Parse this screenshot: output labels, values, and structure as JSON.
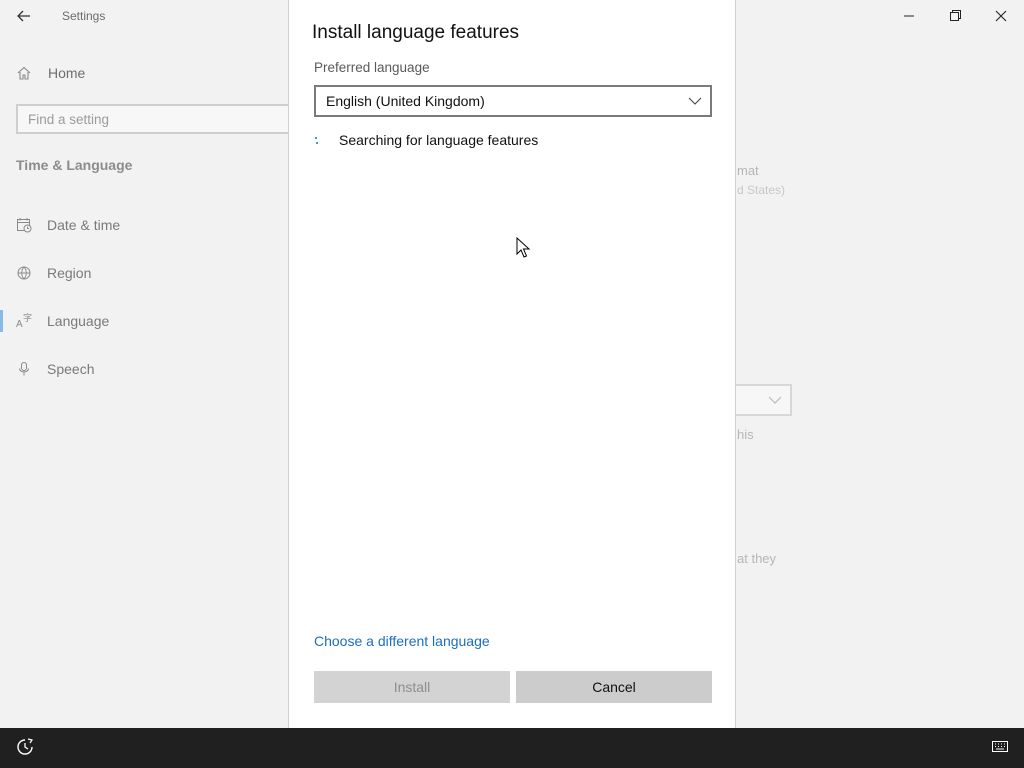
{
  "settings": {
    "app_title": "Settings",
    "home_label": "Home",
    "search_placeholder": "Find a setting",
    "section_title": "Time & Language",
    "nav": [
      {
        "label": "Date & time",
        "icon": "calendar-clock-icon"
      },
      {
        "label": "Region",
        "icon": "globe-icon"
      },
      {
        "label": "Language",
        "icon": "language-icon",
        "selected": true
      },
      {
        "label": "Speech",
        "icon": "microphone-icon"
      }
    ],
    "bg_fragments": {
      "format": "mat",
      "format_value": "d States)",
      "this": "his",
      "they": "at they"
    }
  },
  "dialog": {
    "title": "Install language features",
    "preferred_label": "Preferred language",
    "selected_language": "English (United Kingdom)",
    "status": "Searching for language features",
    "link": "Choose a different language",
    "install_label": "Install",
    "install_enabled": false,
    "cancel_label": "Cancel"
  },
  "colors": {
    "accent": "#0078d7",
    "link": "#1b6fbd",
    "taskbar": "#202020"
  }
}
